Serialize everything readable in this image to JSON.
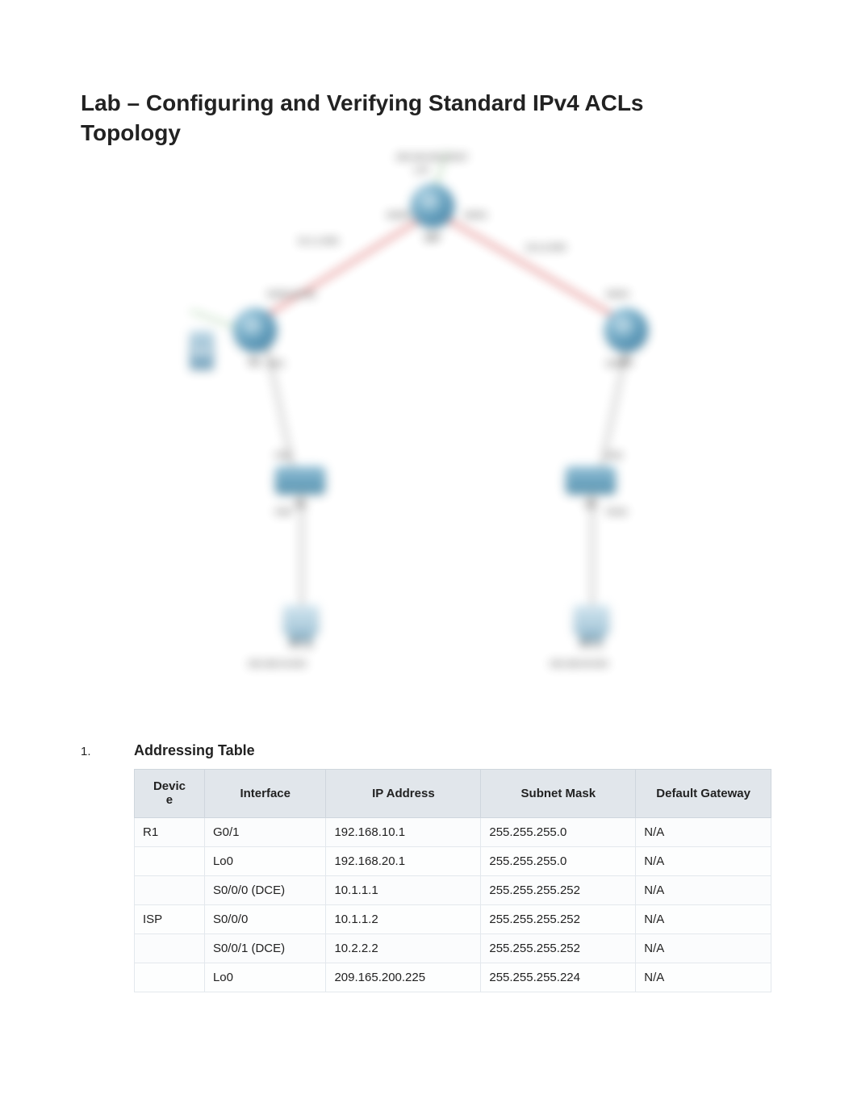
{
  "heading": {
    "title": "Lab – Configuring and Verifying Standard IPv4 ACLs",
    "subtitle": "Topology"
  },
  "diagram": {
    "nodes": {
      "isp": {
        "label": "ISP"
      },
      "r1": {
        "label": "R1"
      },
      "r3": {
        "label": "R3"
      },
      "s1": {
        "label": "S1"
      },
      "s3": {
        "label": "S3"
      },
      "pc_a": {
        "label": "PC-A"
      },
      "pc_c": {
        "label": "PC-C"
      },
      "srv_a": {
        "label": ""
      },
      "srv_c": {
        "label": ""
      }
    },
    "link_labels": {
      "isp_lo0": "Lo0",
      "isp_s000": "S0/0/0",
      "isp_s001": "S0/0/1",
      "r1_s000": "S0/0/0 (DCE)",
      "r3_s001": "S0/0/1",
      "r1_g01": "G0/1",
      "r3_g01": "G0/1",
      "s1_f05": "F0/5",
      "s1_f06": "F0/6",
      "s3_f05": "F0/5",
      "s3_f18": "F0/18",
      "net_left": "192.168.10.0/24",
      "net_right": "192.168.30.0/24",
      "wan_left": "10.1.1.0/30",
      "wan_right": "10.2.2.0/30",
      "lo_net": "209.165.200.224/27"
    }
  },
  "section": {
    "number": "1.",
    "title": "Addressing Table"
  },
  "table": {
    "headers": {
      "device": "Devic\ne",
      "interface": "Interface",
      "ip": "IP Address",
      "mask": "Subnet Mask",
      "gateway": "Default Gateway"
    },
    "rows": [
      {
        "device": "R1",
        "interface": "G0/1",
        "ip": "192.168.10.1",
        "mask": "255.255.255.0",
        "gateway": "N/A"
      },
      {
        "device": "",
        "interface": "Lo0",
        "ip": "192.168.20.1",
        "mask": "255.255.255.0",
        "gateway": "N/A"
      },
      {
        "device": "",
        "interface": "S0/0/0 (DCE)",
        "ip": "10.1.1.1",
        "mask": "255.255.255.252",
        "gateway": "N/A"
      },
      {
        "device": "ISP",
        "interface": "S0/0/0",
        "ip": "10.1.1.2",
        "mask": "255.255.255.252",
        "gateway": "N/A"
      },
      {
        "device": "",
        "interface": "S0/0/1 (DCE)",
        "ip": "10.2.2.2",
        "mask": "255.255.255.252",
        "gateway": "N/A"
      },
      {
        "device": "",
        "interface": "Lo0",
        "ip": "209.165.200.225",
        "mask": "255.255.255.224",
        "gateway": "N/A"
      }
    ]
  }
}
